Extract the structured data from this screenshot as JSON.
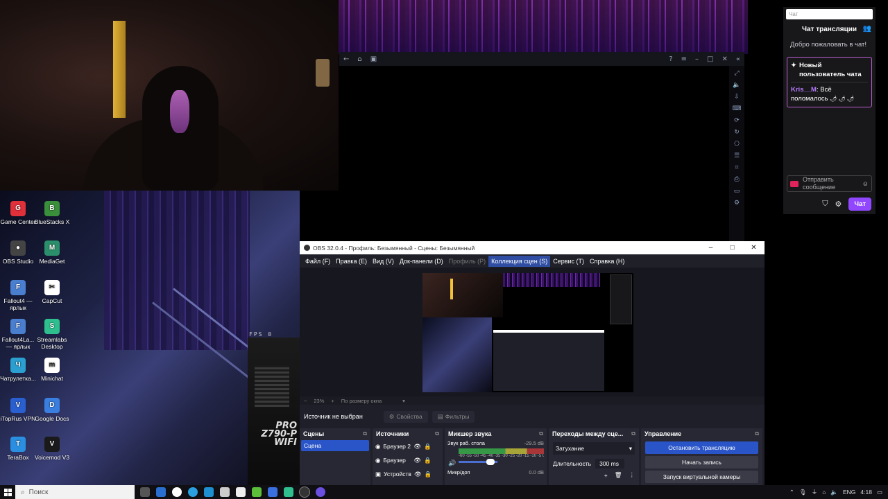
{
  "browser_window": {
    "side_icons": [
      "expand-icon",
      "volume-icon",
      "import-icon",
      "keyboard-icon",
      "refresh-icon",
      "rotate-icon",
      "gamepad-icon",
      "layers-icon",
      "crop-icon",
      "screenshot-icon",
      "folder-icon",
      "settings-icon"
    ]
  },
  "overlay": {
    "fps_text": "FPS   0",
    "mobo_brand": "PRO\nZ790-P\nWIFI"
  },
  "desktop_icons": [
    {
      "label": "Game Center",
      "color": "#e0303a",
      "glyph": "G"
    },
    {
      "label": "BlueStacks X",
      "color": "#3a8f3a",
      "glyph": "B"
    },
    {
      "label": "OBS Studio",
      "color": "#444444",
      "glyph": "●"
    },
    {
      "label": "MediaGet",
      "color": "#2a8f6a",
      "glyph": "M"
    },
    {
      "label": "Fallout4 — ярлык",
      "color": "#4a7fd0",
      "glyph": "F"
    },
    {
      "label": "CapCut",
      "color": "#ffffff",
      "glyph": "✂"
    },
    {
      "label": "Fallout4La... — ярлык",
      "color": "#4a7fd0",
      "glyph": "F"
    },
    {
      "label": "Streamlabs Desktop",
      "color": "#2fbf8f",
      "glyph": "S"
    },
    {
      "label": "Чатрулетка...",
      "color": "#2a9fd0",
      "glyph": "Ч"
    },
    {
      "label": "Minichat",
      "color": "#ffffff",
      "glyph": "m"
    },
    {
      "label": "iTopRus VPN",
      "color": "#2a5fd0",
      "glyph": "V"
    },
    {
      "label": "Google Docs",
      "color": "#3a7fe0",
      "glyph": "D"
    },
    {
      "label": "TeraBox",
      "color": "#2a8fe0",
      "glyph": "T"
    },
    {
      "label": "Voicemod V3",
      "color": "#1a1a1a",
      "glyph": "V"
    }
  ],
  "chat": {
    "search_placeholder": "Чат",
    "title": "Чат трансляции",
    "welcome": "Добро пожаловать в чат!",
    "new_user_label": "Новый пользователь чата",
    "message_user": "Kris__M",
    "message_text": ": Всё поломалось",
    "message_emotes": "🌶 🌶 🌶",
    "input_placeholder": "Отправить сообщение",
    "chat_button": "Чат",
    "accent_color": "#9147ff"
  },
  "obs": {
    "title": "OBS 32.0.4 - Профиль: Безымянный - Сцены: Безымянный",
    "menu": [
      "Файл (F)",
      "Правка (E)",
      "Вид (V)",
      "Док-панели (D)",
      "Профиль (P)",
      "Коллекция сцен (S)",
      "Сервис (T)",
      "Справка (H)"
    ],
    "zoom": "23%",
    "zoom_mode": "По размеру окна",
    "no_source": "Источник не выбран",
    "properties": "Свойства",
    "filters": "Фильтры",
    "scenes_title": "Сцены",
    "scene_name": "Сцена",
    "sources_title": "Источники",
    "sources": [
      "Браузер 2",
      "Браузер",
      "Устройство"
    ],
    "mixer_title": "Микшер звука",
    "mixer_ch1": "Звук раб. стола",
    "mixer_ch1_db": "-29.5 dB",
    "mixer_scale": "-60 -55 -50 -45 -40 -35 -30 -25 -20 -15 -10 -5 0",
    "mixer_ch2": "Микр/доп",
    "mixer_ch2_db": "0.0 dB",
    "transitions_title": "Переходы между сце...",
    "transition": "Затухание",
    "duration_label": "Длительность",
    "duration": "300 ms",
    "controls_title": "Управление",
    "stop_stream": "Остановить трансляцию",
    "start_record": "Начать запись",
    "virtual_cam": "Запуск виртуальной камеры"
  },
  "taskbar": {
    "search": "Поиск",
    "lang": "ENG",
    "time": "4:18"
  }
}
